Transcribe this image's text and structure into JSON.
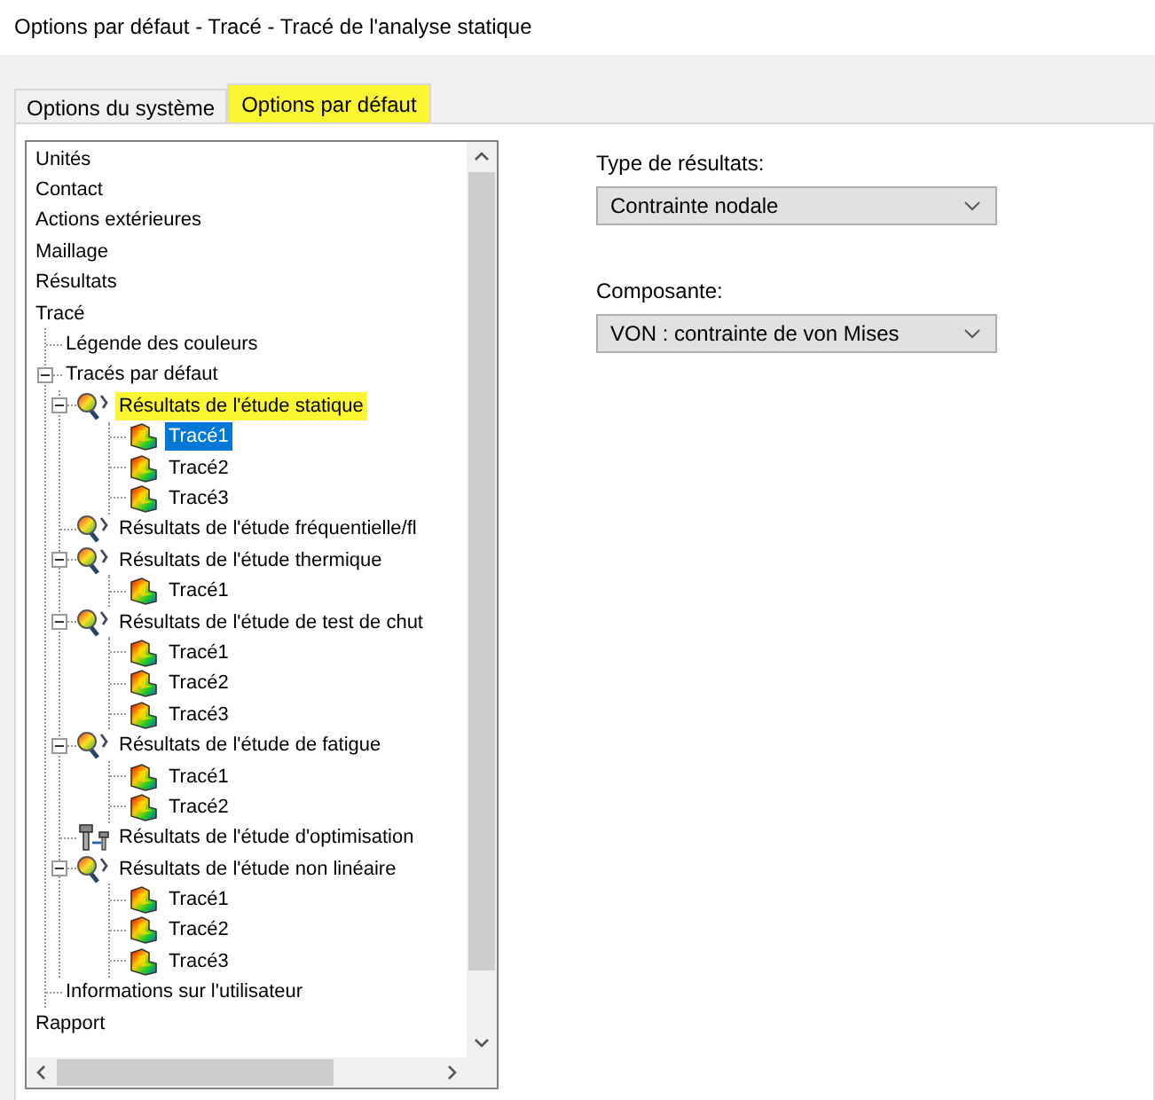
{
  "window": {
    "title": "Options par défaut - Tracé - Tracé de l'analyse statique"
  },
  "tabs": [
    {
      "label": "Options du système",
      "selected": false,
      "highlighted": false
    },
    {
      "label": "Options par défaut",
      "selected": true,
      "highlighted": true
    }
  ],
  "tree": [
    {
      "label": "Unités",
      "selected": false,
      "highlighted": false
    },
    {
      "label": "Contact",
      "selected": false,
      "highlighted": false
    },
    {
      "label": "Actions extérieures",
      "selected": false,
      "highlighted": false
    },
    {
      "label": "Maillage",
      "selected": false,
      "highlighted": false
    },
    {
      "label": "Résultats",
      "selected": false,
      "highlighted": false
    },
    {
      "label": "Tracé",
      "selected": false,
      "highlighted": false,
      "children": [
        {
          "label": "Légende des couleurs",
          "selected": false,
          "highlighted": false
        },
        {
          "label": "Tracés par défaut",
          "selected": false,
          "highlighted": false,
          "expanded": true,
          "children": [
            {
              "label": "Résultats de l'étude statique",
              "kind": "study",
              "selected": false,
              "highlighted": true,
              "expanded": true,
              "children": [
                {
                  "label": "Tracé1",
                  "kind": "plot",
                  "selected": true,
                  "highlighted": false
                },
                {
                  "label": "Tracé2",
                  "kind": "plot",
                  "selected": false,
                  "highlighted": false
                },
                {
                  "label": "Tracé3",
                  "kind": "plot",
                  "selected": false,
                  "highlighted": false
                }
              ]
            },
            {
              "label": "Résultats de l'étude fréquentielle/fl",
              "kind": "study",
              "selected": false,
              "highlighted": false
            },
            {
              "label": "Résultats de l'étude thermique",
              "kind": "study",
              "selected": false,
              "highlighted": false,
              "expanded": true,
              "children": [
                {
                  "label": "Tracé1",
                  "kind": "plot",
                  "selected": false,
                  "highlighted": false
                }
              ]
            },
            {
              "label": "Résultats de l'étude de test de chut",
              "kind": "study",
              "selected": false,
              "highlighted": false,
              "expanded": true,
              "children": [
                {
                  "label": "Tracé1",
                  "kind": "plot",
                  "selected": false,
                  "highlighted": false
                },
                {
                  "label": "Tracé2",
                  "kind": "plot",
                  "selected": false,
                  "highlighted": false
                },
                {
                  "label": "Tracé3",
                  "kind": "plot",
                  "selected": false,
                  "highlighted": false
                }
              ]
            },
            {
              "label": "Résultats de l'étude de fatigue",
              "kind": "study",
              "selected": false,
              "highlighted": false,
              "expanded": true,
              "children": [
                {
                  "label": "Tracé1",
                  "kind": "plot",
                  "selected": false,
                  "highlighted": false
                },
                {
                  "label": "Tracé2",
                  "kind": "plot",
                  "selected": false,
                  "highlighted": false
                }
              ]
            },
            {
              "label": "Résultats de l'étude d'optimisation",
              "kind": "optimization",
              "selected": false,
              "highlighted": false
            },
            {
              "label": "Résultats de l'étude non linéaire",
              "kind": "study",
              "selected": false,
              "highlighted": false,
              "expanded": true,
              "children": [
                {
                  "label": "Tracé1",
                  "kind": "plot",
                  "selected": false,
                  "highlighted": false
                },
                {
                  "label": "Tracé2",
                  "kind": "plot",
                  "selected": false,
                  "highlighted": false
                },
                {
                  "label": "Tracé3",
                  "kind": "plot",
                  "selected": false,
                  "highlighted": false
                }
              ]
            }
          ]
        },
        {
          "label": "Informations sur l'utilisateur",
          "selected": false,
          "highlighted": false
        }
      ]
    },
    {
      "label": "Rapport",
      "selected": false,
      "highlighted": false
    }
  ],
  "fields": [
    {
      "label": "Type de résultats:",
      "value": "Contrainte nodale"
    },
    {
      "label": "Composante:",
      "value": "VON : contrainte de von Mises"
    }
  ]
}
